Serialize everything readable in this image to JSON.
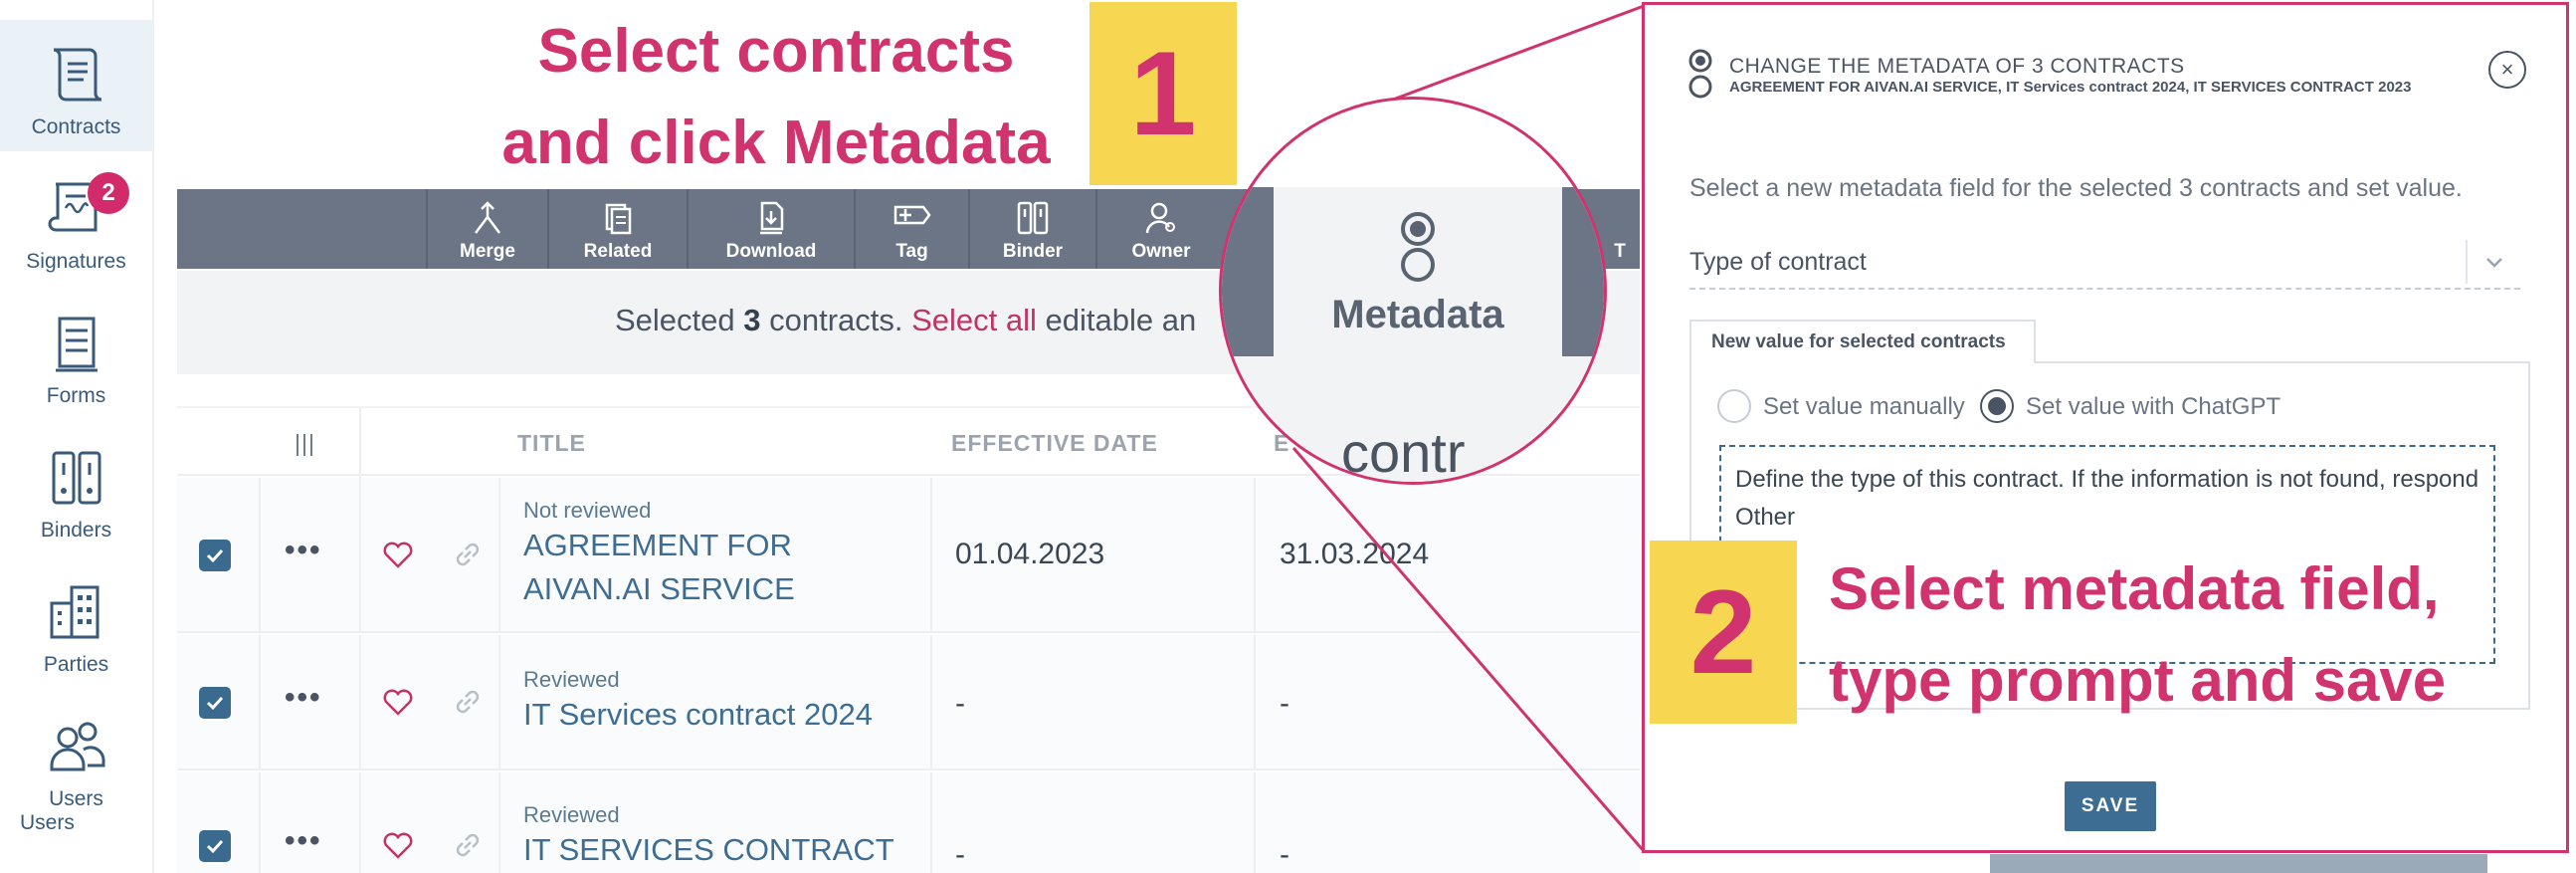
{
  "sidebar": {
    "items": [
      {
        "label": "Contracts",
        "icon": "contract-scroll-icon"
      },
      {
        "label": "Signatures",
        "icon": "signature-icon",
        "badge": "2"
      },
      {
        "label": "Forms",
        "icon": "form-icon"
      },
      {
        "label": "Binders",
        "icon": "binder-icon"
      },
      {
        "label": "Parties",
        "icon": "building-icon"
      },
      {
        "label": "Users",
        "icon": "users-icon"
      }
    ],
    "extra_label": "Users"
  },
  "instructions": {
    "step1_line1": "Select contracts",
    "step1_line2": "and click Metadata",
    "step1_number": "1",
    "step2_number": "2",
    "step2_line1": "Select metadata field,",
    "step2_line2": "type prompt and save"
  },
  "toolbar": {
    "items": [
      {
        "label": "Merge",
        "icon": "merge-icon"
      },
      {
        "label": "Related",
        "icon": "related-icon"
      },
      {
        "label": "Download",
        "icon": "download-icon"
      },
      {
        "label": "Tag",
        "icon": "tag-icon"
      },
      {
        "label": "Binder",
        "icon": "binder-icon"
      },
      {
        "label": "Owner",
        "icon": "owner-icon"
      }
    ],
    "partial_label": "T"
  },
  "zoom": {
    "label": "Metadata",
    "bottom_text": "contr"
  },
  "selection": {
    "prefix": "Selected ",
    "count": "3",
    "middle": " contracts. ",
    "link": "Select all",
    "suffix": " editable an"
  },
  "table": {
    "headers": {
      "columns_icon": "|||",
      "title": "TITLE",
      "effective_date": "EFFECTIVE DATE",
      "end_partial": "E"
    },
    "rows": [
      {
        "status": "Not reviewed",
        "title_line1": "AGREEMENT FOR",
        "title_line2": "AIVAN.AI SERVICE",
        "effective_date": "01.04.2023",
        "end_date": "31.03.2024"
      },
      {
        "status": "Reviewed",
        "title_line1": "IT Services contract 2024",
        "title_line2": "",
        "effective_date": "-",
        "end_date": "-"
      },
      {
        "status": "Reviewed",
        "title_line1": "IT SERVICES CONTRACT",
        "title_line2": "",
        "effective_date": "-",
        "end_date": "-"
      }
    ]
  },
  "modal": {
    "title": "CHANGE THE METADATA OF 3 CONTRACTS",
    "subtitle": "AGREEMENT FOR AIVAN.AI SERVICE, IT Services contract 2024, IT SERVICES CONTRACT 2023",
    "close": "×",
    "description": "Select a new metadata field for the selected 3 contracts and set value.",
    "field_value": "Type of contract",
    "tab_label": "New value for selected contracts",
    "radio_manual": "Set value manually",
    "radio_chatgpt": "Set value with ChatGPT",
    "prompt": "Define the type of this contract. If the information is not found, respond Other",
    "save": "SAVE"
  },
  "colors": {
    "accent": "#d0336d",
    "highlight": "#f7d651",
    "toolbar": "#6b7585",
    "primary": "#3d6d92"
  }
}
